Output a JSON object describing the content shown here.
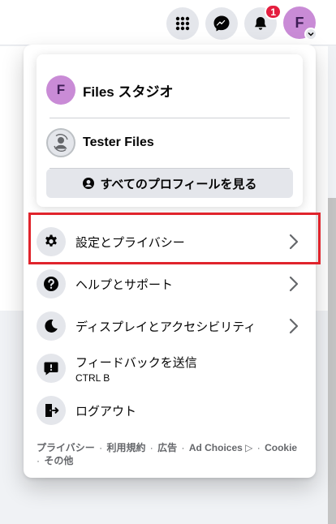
{
  "header": {
    "notification_count": "1",
    "avatar_letter": "F",
    "icons": [
      "apps-grid-icon",
      "messenger-icon",
      "bell-icon",
      "account-avatar"
    ]
  },
  "profiles": {
    "primary": {
      "letter": "F",
      "name": "Files スタジオ"
    },
    "secondary": {
      "name": "Tester Files"
    },
    "see_all_label": "すべてのプロフィールを見る"
  },
  "menu": {
    "settings": "設定とプライバシー",
    "help": "ヘルプとサポート",
    "display": "ディスプレイとアクセシビリティ",
    "feedback": "フィードバックを送信",
    "feedback_shortcut": "CTRL B",
    "logout": "ログアウト"
  },
  "footer": {
    "privacy": "プライバシー",
    "terms": "利用規約",
    "ads": "広告",
    "ad_choices": "Ad Choices",
    "cookie": "Cookie",
    "more": "その他",
    "separator": " · "
  },
  "colors": {
    "accent_highlight": "#e0242c",
    "avatar_bg": "#c98bd6",
    "badge_red": "#e41e3f"
  }
}
